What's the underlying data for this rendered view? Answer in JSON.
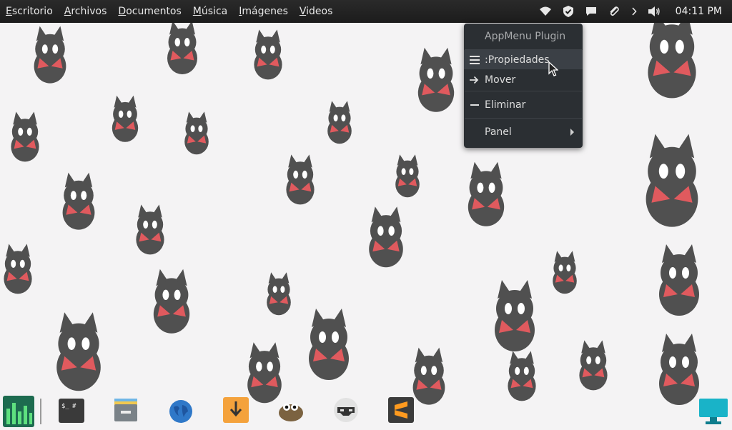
{
  "topbar": {
    "places": [
      {
        "mnemonic": "E",
        "rest": "scritorio"
      },
      {
        "mnemonic": "A",
        "rest": "rchivos"
      },
      {
        "mnemonic": "D",
        "rest": "ocumentos"
      },
      {
        "mnemonic": "M",
        "rest": "úsica"
      },
      {
        "mnemonic": "I",
        "rest": "mágenes"
      },
      {
        "mnemonic": "V",
        "rest": "ideos"
      }
    ],
    "tray_icons": [
      "wifi-icon",
      "shield-icon",
      "chat-icon",
      "paperclip-icon",
      "chevron-right-icon",
      "volume-icon"
    ],
    "clock": "04:11 PM"
  },
  "context_menu": {
    "title": "AppMenu Plugin",
    "items": [
      {
        "label": ":Propiedades",
        "icon": "list-icon"
      },
      {
        "label": "Mover",
        "icon": "arrow-right-icon"
      },
      {
        "label": "Eliminar",
        "icon": "minus-icon"
      },
      {
        "label": "Panel",
        "icon": "",
        "submenu": true
      }
    ]
  },
  "dock": {
    "apps": [
      "equalizer-app-icon",
      "terminal-app-icon",
      "files-app-icon",
      "browser-globe-icon",
      "download-manager-icon",
      "gimp-icon",
      "game-controller-icon",
      "sublime-text-icon",
      "display-app-icon"
    ]
  },
  "colors": {
    "topbar": "#1f1f1f",
    "menu": "#2b2f33",
    "menu_highlight": "#3b4046",
    "wallpaper": "#f4f3f4",
    "cat": "#505050",
    "ribbon": "#e05a5e"
  }
}
